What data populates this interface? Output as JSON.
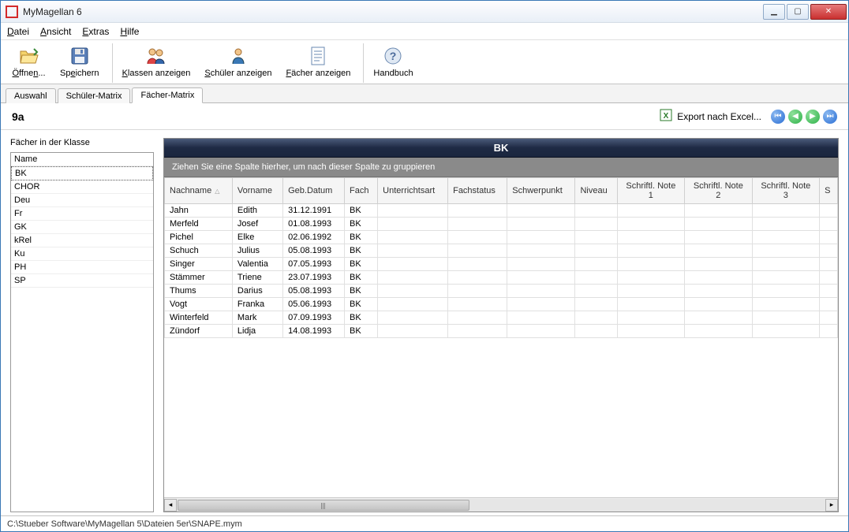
{
  "window": {
    "title": "MyMagellan 6"
  },
  "menu": {
    "file": "Datei",
    "view": "Ansicht",
    "extras": "Extras",
    "help": "Hilfe"
  },
  "toolbar": {
    "open": "Öffnen...",
    "save": "Speichern",
    "show_classes": "Klassen anzeigen",
    "show_students": "Schüler anzeigen",
    "show_subjects": "Fächer anzeigen",
    "handbook": "Handbuch"
  },
  "tabs": {
    "selection": "Auswahl",
    "student_matrix": "Schüler-Matrix",
    "subject_matrix": "Fächer-Matrix"
  },
  "info": {
    "class_name": "9a",
    "export": "Export nach Excel..."
  },
  "left": {
    "heading": "Fächer in der Klasse",
    "header": "Name",
    "items": [
      "BK",
      "CHOR",
      "Deu",
      "Fr",
      "GK",
      "kRel",
      "Ku",
      "PH",
      "SP"
    ],
    "selected": "BK"
  },
  "grid": {
    "title": "BK",
    "group_hint": "Ziehen Sie eine Spalte hierher, um nach dieser Spalte zu gruppieren",
    "columns": [
      "Nachname",
      "Vorname",
      "Geb.Datum",
      "Fach",
      "Unterrichtsart",
      "Fachstatus",
      "Schwerpunkt",
      "Niveau",
      "Schriftl. Note 1",
      "Schriftl. Note 2",
      "Schriftl. Note 3",
      "S"
    ],
    "sort_col": 0,
    "rows": [
      {
        "nachname": "Jahn",
        "vorname": "Edith",
        "geb": "31.12.1991",
        "fach": "BK"
      },
      {
        "nachname": "Merfeld",
        "vorname": "Josef",
        "geb": "01.08.1993",
        "fach": "BK"
      },
      {
        "nachname": "Pichel",
        "vorname": "Elke",
        "geb": "02.06.1992",
        "fach": "BK"
      },
      {
        "nachname": "Schuch",
        "vorname": "Julius",
        "geb": "05.08.1993",
        "fach": "BK"
      },
      {
        "nachname": "Singer",
        "vorname": "Valentia",
        "geb": "07.05.1993",
        "fach": "BK"
      },
      {
        "nachname": "Stämmer",
        "vorname": "Triene",
        "geb": "23.07.1993",
        "fach": "BK"
      },
      {
        "nachname": "Thums",
        "vorname": "Darius",
        "geb": "05.08.1993",
        "fach": "BK"
      },
      {
        "nachname": "Vogt",
        "vorname": "Franka",
        "geb": "05.06.1993",
        "fach": "BK"
      },
      {
        "nachname": "Winterfeld",
        "vorname": "Mark",
        "geb": "07.09.1993",
        "fach": "BK"
      },
      {
        "nachname": "Zündorf",
        "vorname": "Lidja",
        "geb": "14.08.1993",
        "fach": "BK"
      }
    ]
  },
  "status": {
    "path": "C:\\Stueber Software\\MyMagellan 5\\Dateien 5er\\SNAPE.mym"
  },
  "colors": {
    "nav_first": "#2b6fd4",
    "nav_prev": "#2fb24a",
    "nav_next": "#2fb24a",
    "nav_last": "#2b6fd4"
  }
}
